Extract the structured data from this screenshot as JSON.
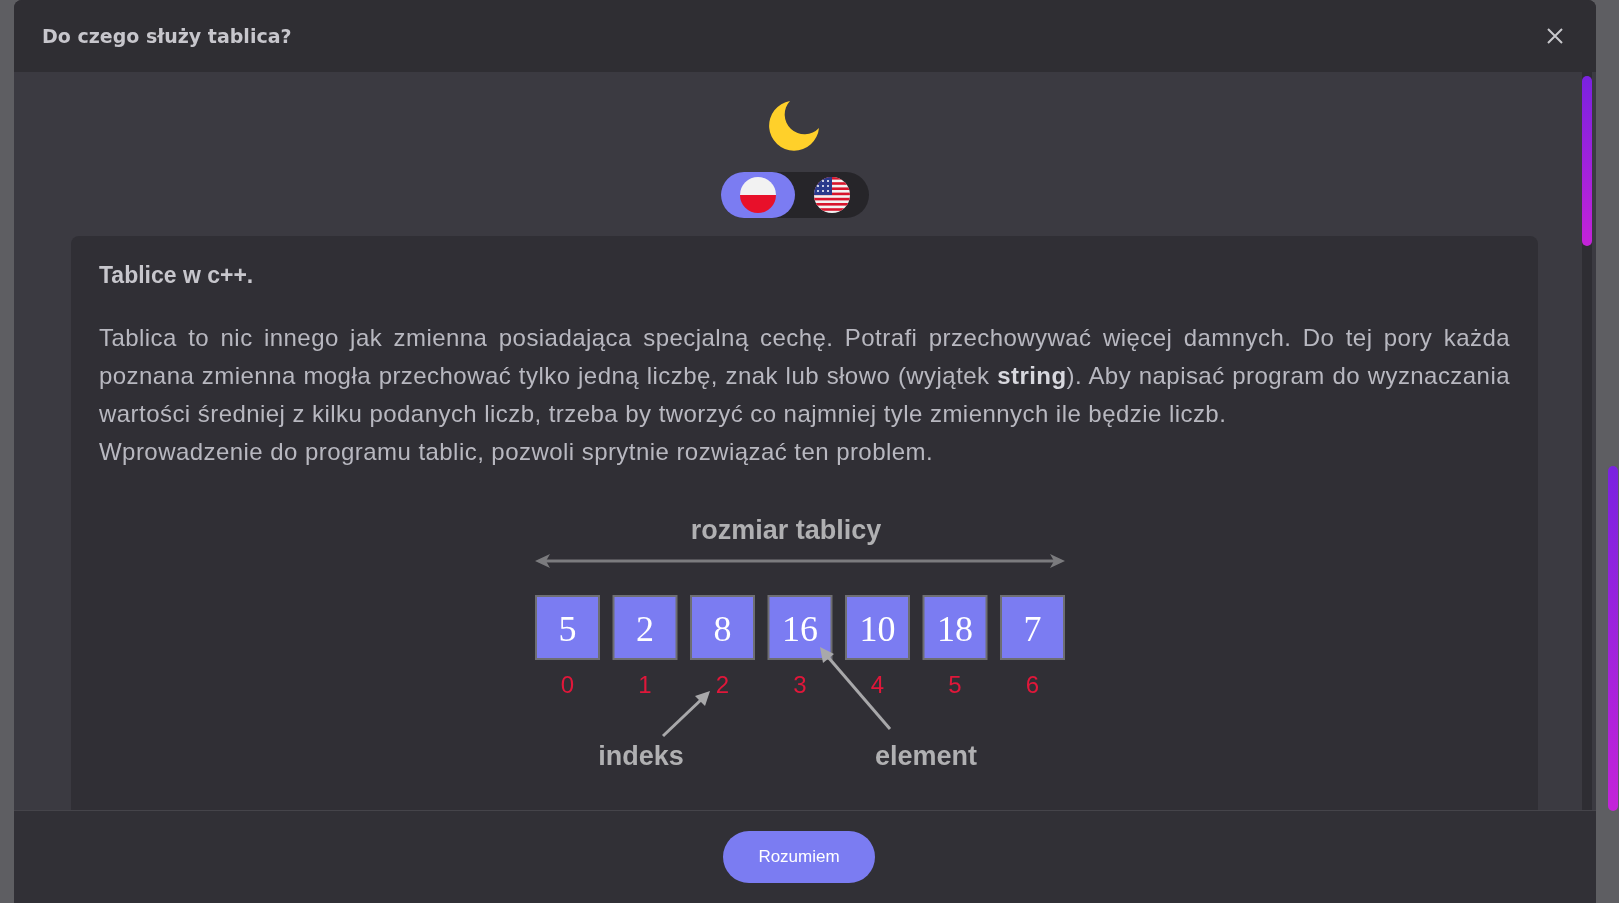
{
  "dialog": {
    "title": "Do czego służy tablica?"
  },
  "languages": [
    {
      "kind": "poland",
      "selected": true
    },
    {
      "kind": "usa",
      "selected": false
    }
  ],
  "card": {
    "heading": "Tablice w c++.",
    "paragraphs": [
      "Tablica to nic innego jak zmienna posiadająca specjalną cechę. Potrafi przechowywać więcej damnych. Do tej pory każda poznana zmienna mogła przechować tylko jedną liczbę, znak lub słowo (wyjątek **string**). Aby napisać program do wyznaczania wartości średniej z kilku podanych liczb, trzeba by tworzyć co najmniej tyle zmiennych ile będzie liczb.",
      "Wprowadzenie do programu tablic, pozwoli sprytnie rozwiązać ten problem."
    ],
    "diagram": {
      "size_label": "rozmiar tablicy",
      "cells": [
        {
          "value": "5",
          "index": "0"
        },
        {
          "value": "2",
          "index": "1"
        },
        {
          "value": "8",
          "index": "2"
        },
        {
          "value": "16",
          "index": "3"
        },
        {
          "value": "10",
          "index": "4"
        },
        {
          "value": "18",
          "index": "5"
        },
        {
          "value": "7",
          "index": "6"
        }
      ],
      "index_label": "indeks",
      "element_label": "element"
    }
  },
  "footer": {
    "button": "Rozumiem"
  }
}
